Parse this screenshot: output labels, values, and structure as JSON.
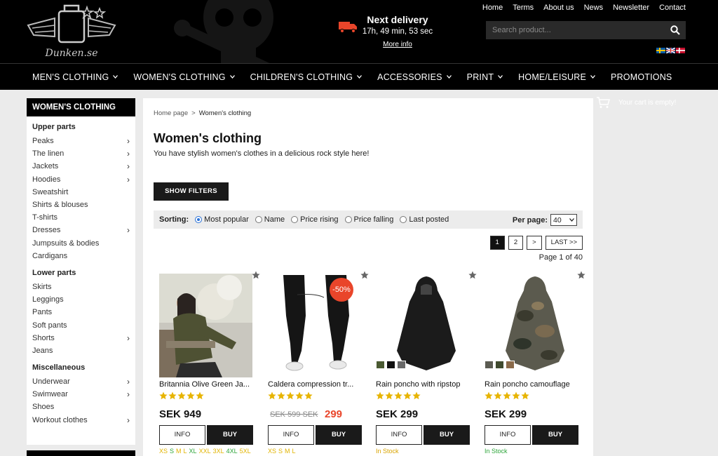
{
  "header": {
    "logo_text": "Dunken.se",
    "delivery_title": "Next delivery",
    "delivery_time": "17h, 49 min, 53 sec",
    "delivery_more": "More info",
    "top_links": [
      "Home",
      "Terms",
      "About us",
      "News",
      "Newsletter",
      "Contact"
    ],
    "search_placeholder": "Search product...",
    "flags": [
      "flag-sweden-icon",
      "flag-uk-icon",
      "flag-denmark-icon"
    ]
  },
  "nav": {
    "items": [
      {
        "label": "MEN'S CLOTHING",
        "dropdown": true
      },
      {
        "label": "WOMEN'S CLOTHING",
        "dropdown": true
      },
      {
        "label": "CHILDREN'S CLOTHING",
        "dropdown": true
      },
      {
        "label": "ACCESSORIES",
        "dropdown": true
      },
      {
        "label": "PRINT",
        "dropdown": true
      },
      {
        "label": "HOME/LEISURE",
        "dropdown": true
      },
      {
        "label": "PROMOTIONS",
        "dropdown": false
      }
    ]
  },
  "sidebar": {
    "heading": "WOMEN'S CLOTHING",
    "groups": [
      {
        "title": "Upper parts",
        "items": [
          {
            "label": "Peaks",
            "arrow": true
          },
          {
            "label": "The linen",
            "arrow": true
          },
          {
            "label": "Jackets",
            "arrow": true
          },
          {
            "label": "Hoodies",
            "arrow": true
          },
          {
            "label": "Sweatshirt",
            "arrow": false
          },
          {
            "label": "Shirts & blouses",
            "arrow": false
          },
          {
            "label": "T-shirts",
            "arrow": false
          },
          {
            "label": "Dresses",
            "arrow": true
          },
          {
            "label": "Jumpsuits & bodies",
            "arrow": false
          },
          {
            "label": "Cardigans",
            "arrow": false
          }
        ]
      },
      {
        "title": "Lower parts",
        "items": [
          {
            "label": "Skirts",
            "arrow": false
          },
          {
            "label": "Leggings",
            "arrow": false
          },
          {
            "label": "Pants",
            "arrow": false
          },
          {
            "label": "Soft pants",
            "arrow": false
          },
          {
            "label": "Shorts",
            "arrow": true
          },
          {
            "label": "Jeans",
            "arrow": false
          }
        ]
      },
      {
        "title": "Miscellaneous",
        "items": [
          {
            "label": "Underwear",
            "arrow": true
          },
          {
            "label": "Swimwear",
            "arrow": true
          },
          {
            "label": "Shoes",
            "arrow": false
          },
          {
            "label": "Workout clothes",
            "arrow": true
          }
        ]
      }
    ]
  },
  "main": {
    "breadcrumb_home": "Home page",
    "breadcrumb_sep": ">",
    "breadcrumb_current": "Women's clothing",
    "title": "Women's clothing",
    "description": "You have stylish women's clothes in a delicious rock style here!",
    "filters_button": "SHOW FILTERS",
    "sort_label": "Sorting:",
    "sort_options": [
      {
        "label": "Most popular",
        "selected": true
      },
      {
        "label": "Name",
        "selected": false
      },
      {
        "label": "Price rising",
        "selected": false
      },
      {
        "label": "Price falling",
        "selected": false
      },
      {
        "label": "Last posted",
        "selected": false
      }
    ],
    "per_page_label": "Per page:",
    "per_page_value": "40",
    "pagination": [
      "1",
      "2",
      ">",
      "LAST >>"
    ],
    "page_info": "Page 1 of 40"
  },
  "cart": {
    "text": "Your cart is empty!"
  },
  "products": [
    {
      "name": "Britannia Olive Green Ja...",
      "price": "SEK 949",
      "rating": 5,
      "info": "INFO",
      "buy": "BUY",
      "sizes": [
        {
          "s": "XS",
          "c": "y"
        },
        {
          "s": "S",
          "c": "g"
        },
        {
          "s": "M",
          "c": "y"
        },
        {
          "s": "L",
          "c": "y"
        },
        {
          "s": "XL",
          "c": "g"
        },
        {
          "s": "XXL",
          "c": "y"
        },
        {
          "s": "3XL",
          "c": "y"
        },
        {
          "s": "4XL",
          "c": "g"
        },
        {
          "s": "5XL",
          "c": "y"
        }
      ]
    },
    {
      "name": "Caldera compression tr...",
      "old_price": "SEK 599 SEK",
      "new_price": "299",
      "sale_badge": "-50%",
      "rating": 5,
      "info": "INFO",
      "buy": "BUY",
      "sizes": [
        {
          "s": "XS",
          "c": "y"
        },
        {
          "s": "S",
          "c": "y"
        },
        {
          "s": "M",
          "c": "y"
        },
        {
          "s": "L",
          "c": "y"
        }
      ]
    },
    {
      "name": "Rain poncho with ripstop",
      "price": "SEK 299",
      "rating": 5,
      "info": "INFO",
      "buy": "BUY",
      "stock": "In Stock",
      "stock_color": "y",
      "swatch_colors": [
        "#4a5a32",
        "#111111",
        "#6a6a6a"
      ]
    },
    {
      "name": "Rain poncho camouflage",
      "price": "SEK 299",
      "rating": 5,
      "info": "INFO",
      "buy": "BUY",
      "stock": "In Stock",
      "stock_color": "g",
      "swatch_colors": [
        "#5b5b52",
        "#3f4a2e",
        "#8a6a4a"
      ]
    }
  ],
  "colors": {
    "accent": "#e9452a",
    "star": "#e7b400",
    "instock_green": "#2da53a",
    "instock_yellow": "#d9a400"
  }
}
